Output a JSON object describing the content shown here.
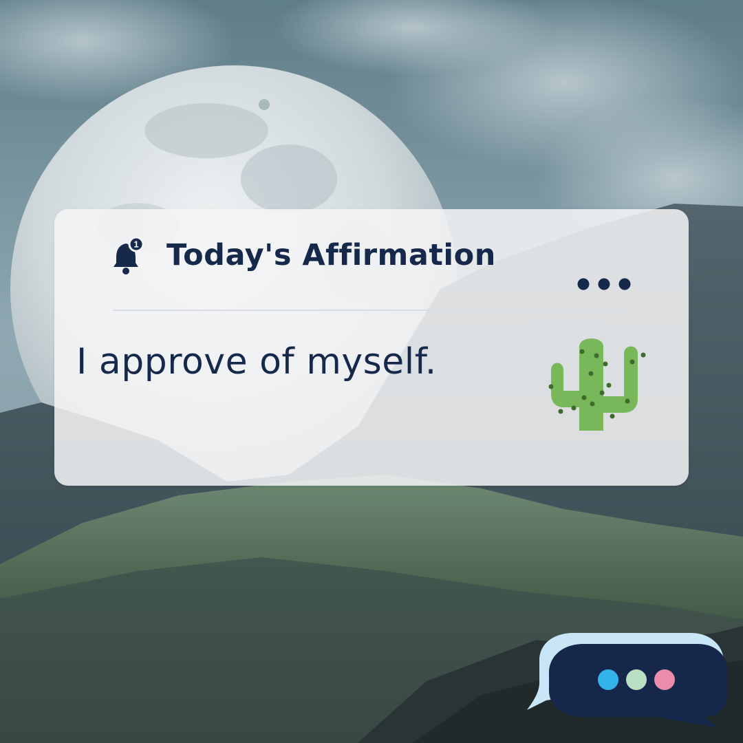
{
  "notification": {
    "title": "Today's Affirmation",
    "badge_count": "1",
    "message": "I approve of myself.",
    "menu_icon": "more-horizontal-icon",
    "bell_icon": "bell-icon",
    "emoji_icon": "cactus-icon"
  },
  "chat_bubble": {
    "icon": "chat-bubble-icon",
    "dot_colors": [
      "#33b5ec",
      "#b9e0c2",
      "#ec8cad"
    ]
  },
  "colors": {
    "text": "#16294a",
    "card_bg": "#f4f5f6",
    "bubble_dark": "#15284b",
    "bubble_light": "#c8e6f6",
    "cactus": "#79b85a"
  }
}
